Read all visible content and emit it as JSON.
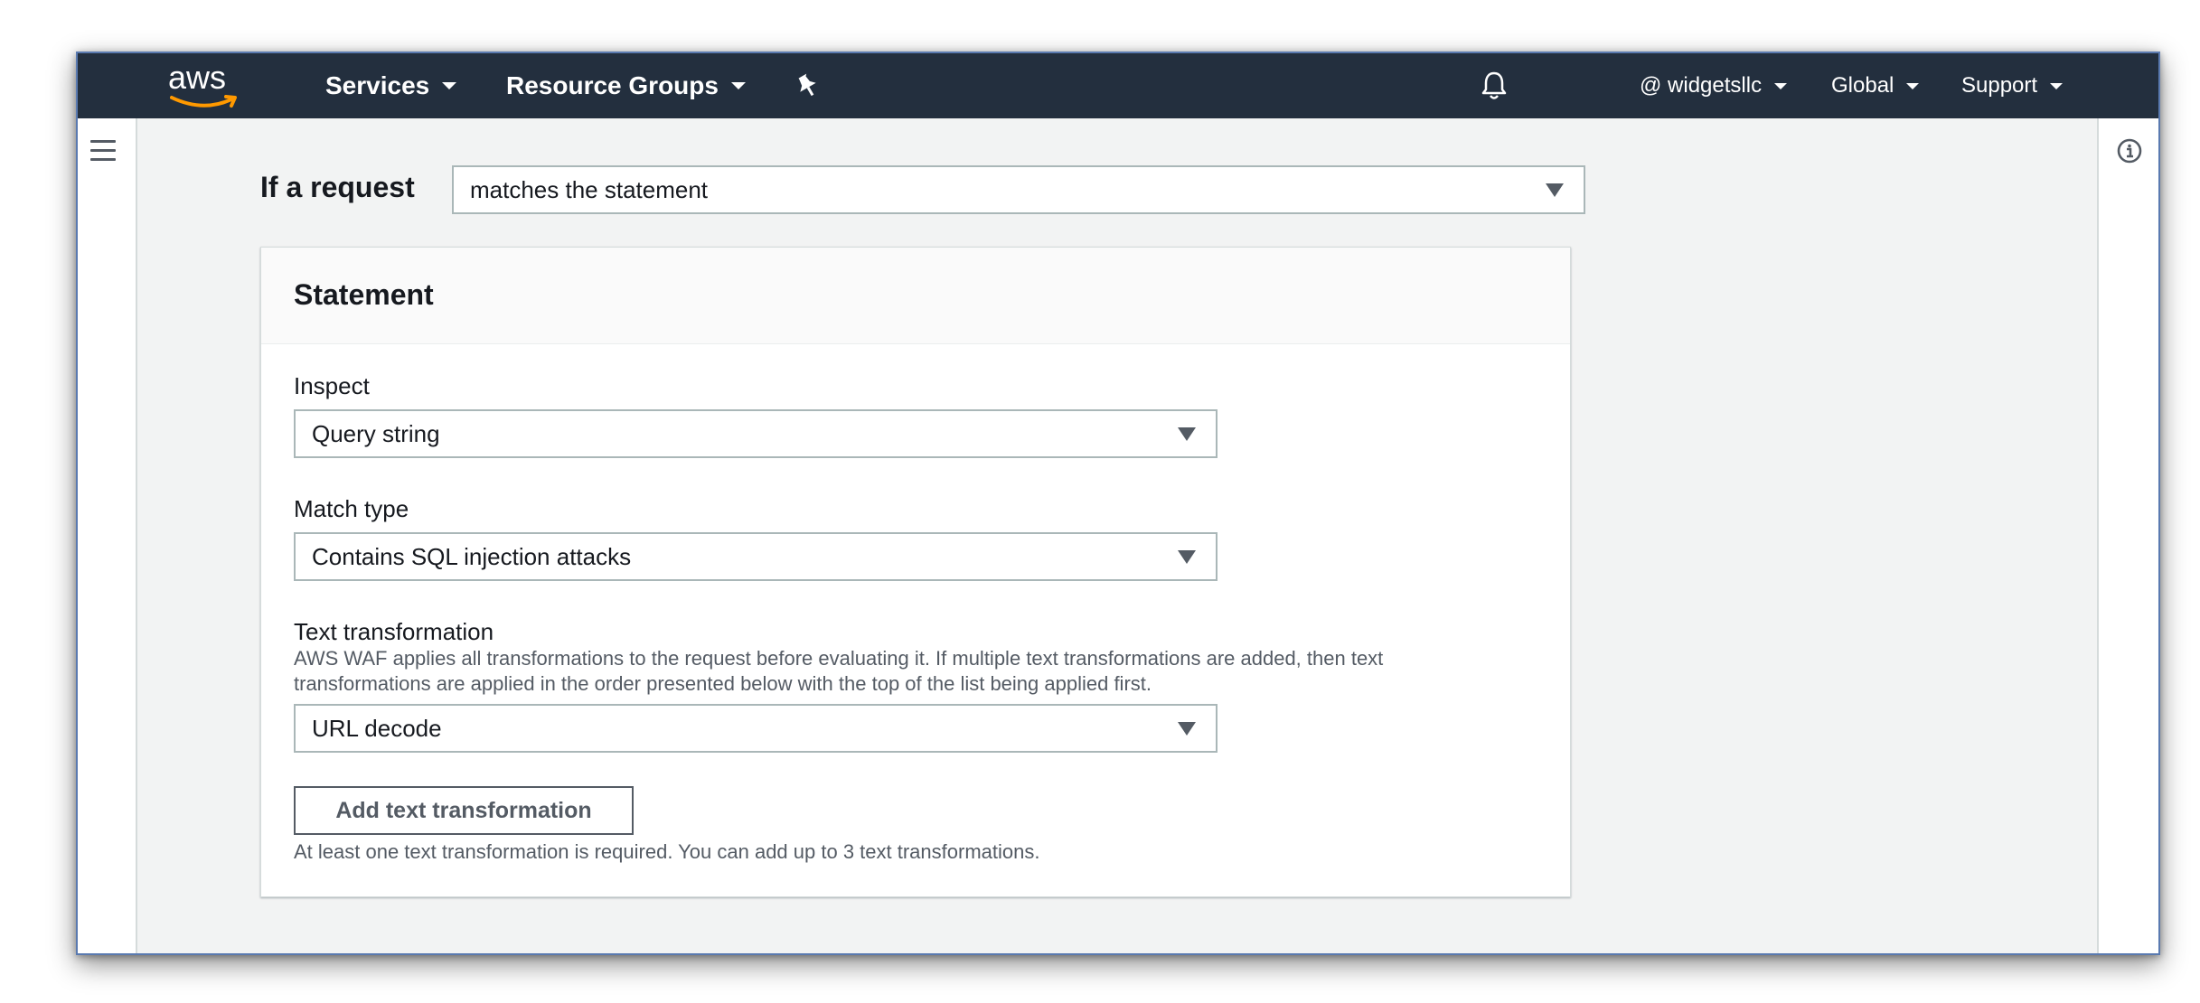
{
  "nav": {
    "logo_text": "aws",
    "services": "Services",
    "resource_groups": "Resource Groups",
    "account": "@ widgetsllc",
    "region": "Global",
    "support": "Support"
  },
  "rule": {
    "if_label": "If a request",
    "condition_value": "matches the statement"
  },
  "statement": {
    "title": "Statement",
    "inspect_label": "Inspect",
    "inspect_value": "Query string",
    "match_type_label": "Match type",
    "match_type_value": "Contains SQL injection attacks",
    "text_transformation_label": "Text transformation",
    "text_transformation_desc": "AWS WAF applies all transformations to the request before evaluating it. If multiple text transformations are added, then text transformations are applied in the order presented below with the top of the list being applied first.",
    "text_transformation_value": "URL decode",
    "add_button": "Add text transformation",
    "hint": "At least one text transformation is required. You can add up to 3 text transformations."
  },
  "colors": {
    "nav_bg": "#232f3e",
    "aws_smile": "#ff9900",
    "page_bg": "#f2f3f3"
  },
  "icons": [
    "pin-icon",
    "bell-icon",
    "hamburger-icon",
    "info-icon",
    "caret-down-icon"
  ]
}
